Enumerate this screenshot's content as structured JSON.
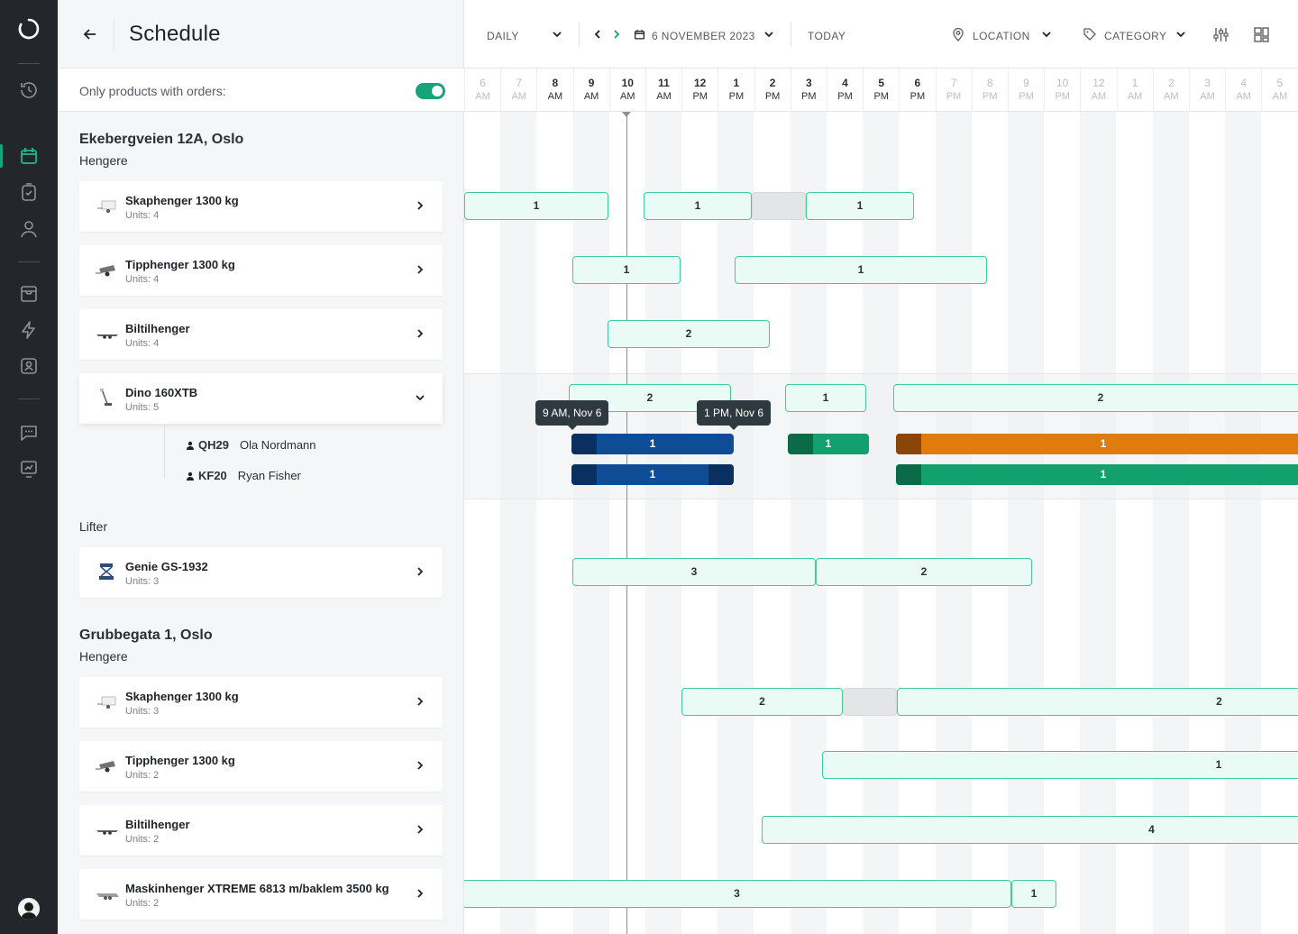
{
  "header": {
    "title": "Schedule"
  },
  "filter": {
    "label": "Only products with orders:",
    "enabled": true
  },
  "toolbar": {
    "view": "DAILY",
    "date": "6 NOVEMBER 2023",
    "today": "TODAY",
    "location": "LOCATION",
    "category": "CATEGORY"
  },
  "hours": [
    {
      "h": "6",
      "ap": "AM",
      "dim": true
    },
    {
      "h": "7",
      "ap": "AM",
      "dim": true
    },
    {
      "h": "8",
      "ap": "AM",
      "dim": false
    },
    {
      "h": "9",
      "ap": "AM",
      "dim": false
    },
    {
      "h": "10",
      "ap": "AM",
      "dim": false
    },
    {
      "h": "11",
      "ap": "AM",
      "dim": false
    },
    {
      "h": "12",
      "ap": "PM",
      "dim": false
    },
    {
      "h": "1",
      "ap": "PM",
      "dim": false
    },
    {
      "h": "2",
      "ap": "PM",
      "dim": false
    },
    {
      "h": "3",
      "ap": "PM",
      "dim": false
    },
    {
      "h": "4",
      "ap": "PM",
      "dim": false
    },
    {
      "h": "5",
      "ap": "PM",
      "dim": false
    },
    {
      "h": "6",
      "ap": "PM",
      "dim": false
    },
    {
      "h": "7",
      "ap": "PM",
      "dim": true
    },
    {
      "h": "8",
      "ap": "PM",
      "dim": true
    },
    {
      "h": "9",
      "ap": "PM",
      "dim": true
    },
    {
      "h": "10",
      "ap": "PM",
      "dim": true
    },
    {
      "h": "12",
      "ap": "AM",
      "dim": true
    },
    {
      "h": "1",
      "ap": "AM",
      "dim": true
    },
    {
      "h": "2",
      "ap": "AM",
      "dim": true
    },
    {
      "h": "3",
      "ap": "AM",
      "dim": true
    },
    {
      "h": "4",
      "ap": "AM",
      "dim": true
    },
    {
      "h": "5",
      "ap": "AM",
      "dim": true
    }
  ],
  "locations": [
    {
      "name": "Ekebergveien 12A, Oslo",
      "categories": [
        {
          "name": "Hengere",
          "products": [
            {
              "name": "Skaphenger 1300 kg",
              "units": "Units: 4"
            },
            {
              "name": "Tipphenger 1300 kg",
              "units": "Units: 4"
            },
            {
              "name": "Biltilhenger",
              "units": "Units: 4"
            },
            {
              "name": "Dino 160XTB",
              "units": "Units: 5",
              "unit_rows": [
                {
                  "code": "QH29",
                  "person": "Ola Nordmann"
                },
                {
                  "code": "KF20",
                  "person": "Ryan Fisher"
                }
              ]
            }
          ]
        },
        {
          "name": "Lifter",
          "products": [
            {
              "name": "Genie GS-1932",
              "units": "Units: 3"
            }
          ]
        }
      ]
    },
    {
      "name": "Grubbegata 1, Oslo",
      "categories": [
        {
          "name": "Hengere",
          "products": [
            {
              "name": "Skaphenger 1300 kg",
              "units": "Units: 3"
            },
            {
              "name": "Tipphenger 1300 kg",
              "units": "Units: 2"
            },
            {
              "name": "Biltilhenger",
              "units": "Units: 2"
            },
            {
              "name": "Maskinhenger XTREME 6813 m/baklem 3500 kg",
              "units": "Units: 2"
            }
          ]
        }
      ]
    }
  ],
  "bookings": {
    "r1": [
      "1",
      "1",
      "1"
    ],
    "r2": [
      "1",
      "1"
    ],
    "r3": [
      "2"
    ],
    "r4": [
      "2",
      "1",
      "2"
    ],
    "u1": [
      "1",
      "1",
      "1"
    ],
    "u2": [
      "1",
      "1"
    ],
    "r5": [
      "3",
      "2"
    ],
    "r6": [
      "2",
      "2"
    ],
    "r7": [
      "1"
    ],
    "r8": [
      "4"
    ],
    "r9": [
      "3",
      "1"
    ]
  },
  "tooltips": {
    "start": "9 AM, Nov 6",
    "end": "1 PM, Nov 6"
  },
  "colors": {
    "accent": "#17a37a",
    "booking_bg": "#e9fbf4",
    "booking_border": "#3fcc9a",
    "blue": "#0f4c96",
    "orange": "#e07c0e",
    "green": "#12a06e"
  }
}
